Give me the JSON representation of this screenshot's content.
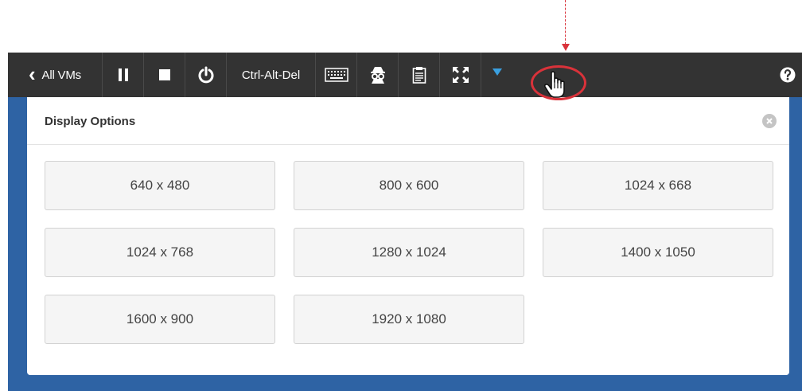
{
  "toolbar": {
    "back_label": "All VMs",
    "ctrl_alt_del_label": "Ctrl-Alt-Del",
    "icons": [
      "chevron-left-icon",
      "pause-icon",
      "stop-icon",
      "power-icon",
      "keyboard-icon",
      "spy-icon",
      "clipboard-icon",
      "fullscreen-icon",
      "dropdown-triangle-icon",
      "help-icon"
    ]
  },
  "dialog": {
    "title": "Display Options",
    "resolutions": [
      "640 x 480",
      "800 x 600",
      "1024 x 668",
      "1024 x 768",
      "1280 x 1024",
      "1400 x 1050",
      "1600 x 900",
      "1920 x 1080"
    ]
  },
  "colors": {
    "toolbar_bg": "#333333",
    "workspace_bg": "#2e63a4",
    "annotation_red": "#d9323a",
    "dropdown_accent": "#3aa0e0"
  }
}
